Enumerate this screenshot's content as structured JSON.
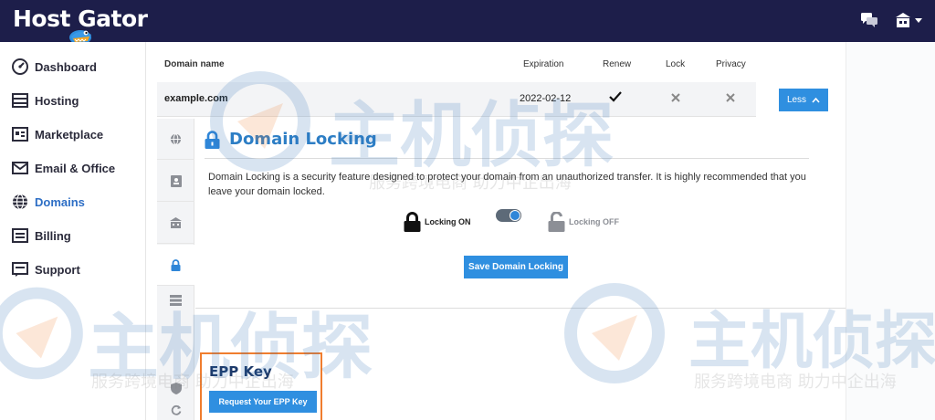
{
  "brand": {
    "logo_text": "Host Gator",
    "topbar_color": "#1d1e4a",
    "accent": "#2f8fe0",
    "highlight_box": "#f07d2e"
  },
  "topbar": {
    "icons": [
      "chat-icon",
      "account-icon"
    ]
  },
  "sidebar": {
    "items": [
      {
        "label": "Dashboard",
        "icon": "dashboard-icon",
        "active": false
      },
      {
        "label": "Hosting",
        "icon": "hosting-icon",
        "active": false
      },
      {
        "label": "Marketplace",
        "icon": "marketplace-icon",
        "active": false
      },
      {
        "label": "Email & Office",
        "icon": "email-icon",
        "active": false
      },
      {
        "label": "Domains",
        "icon": "globe-icon",
        "active": true
      },
      {
        "label": "Billing",
        "icon": "billing-icon",
        "active": false
      },
      {
        "label": "Support",
        "icon": "support-icon",
        "active": false
      }
    ]
  },
  "table": {
    "headers": {
      "domain_name": "Domain name",
      "expiration": "Expiration",
      "renew": "Renew",
      "lock": "Lock",
      "privacy": "Privacy"
    },
    "row": {
      "domain": "example.com",
      "expiration": "2022-02-12",
      "renew": "check",
      "lock": "x",
      "privacy": "x"
    },
    "less_label": "Less"
  },
  "tabs": [
    "globe-icon",
    "contact-icon",
    "nameserver-icon",
    "lock-icon",
    "dns-icon",
    "shield-icon",
    "refresh-icon"
  ],
  "domain_locking": {
    "title": "Domain Locking",
    "description": "Domain Locking is a security feature designed to protect your domain from an unauthorized transfer. It is highly recommended that you leave your domain locked.",
    "locking_on_label": "Locking ON",
    "locking_off_label": "Locking OFF",
    "toggle_state": "on",
    "save_label": "Save Domain Locking"
  },
  "epp": {
    "title": "EPP Key",
    "button_label": "Request Your EPP Key"
  },
  "watermark": {
    "main": "主机侦探",
    "sub": "服务跨境电商 助力中企出海"
  }
}
